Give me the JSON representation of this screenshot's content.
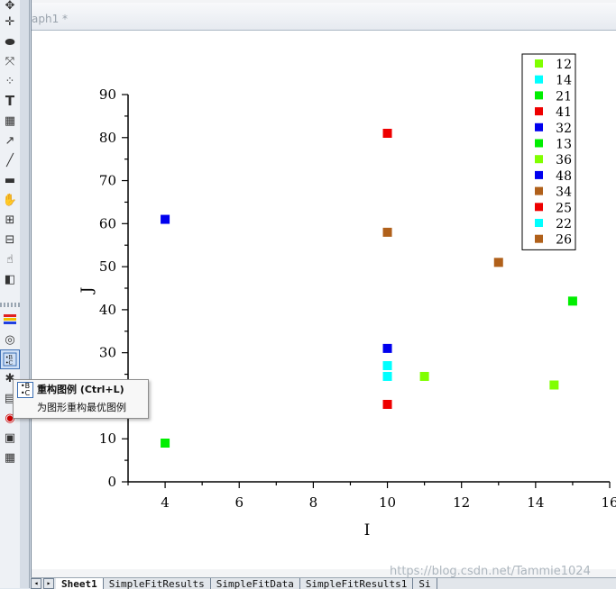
{
  "window": {
    "title": "aph1 *"
  },
  "chart_data": {
    "type": "scatter",
    "title": "",
    "xlabel": "I",
    "ylabel": "J",
    "xlim": [
      3,
      16
    ],
    "ylim": [
      0,
      90
    ],
    "xticks": [
      4,
      6,
      8,
      10,
      12,
      14,
      16
    ],
    "yticks": [
      0,
      10,
      20,
      30,
      40,
      50,
      60,
      70,
      80,
      90
    ],
    "legend_position": "top-right",
    "series": [
      {
        "name": "12",
        "color": "#80ff00",
        "points": [
          [
            14.5,
            22.5
          ]
        ]
      },
      {
        "name": "14",
        "color": "#00ffff",
        "points": [
          [
            10,
            24.5
          ]
        ]
      },
      {
        "name": "21",
        "color": "#00ee00",
        "points": [
          [
            4,
            9
          ]
        ]
      },
      {
        "name": "41",
        "color": "#ee0000",
        "points": [
          [
            10,
            81
          ]
        ]
      },
      {
        "name": "32",
        "color": "#0000ee",
        "points": [
          [
            10,
            31
          ]
        ]
      },
      {
        "name": "13",
        "color": "#00ee00",
        "points": [
          [
            15,
            42
          ]
        ]
      },
      {
        "name": "36",
        "color": "#80ff00",
        "points": [
          [
            11,
            24.5
          ]
        ]
      },
      {
        "name": "48",
        "color": "#0000ee",
        "points": [
          [
            4,
            61
          ]
        ]
      },
      {
        "name": "34",
        "color": "#b0601a",
        "points": [
          [
            10,
            58
          ]
        ]
      },
      {
        "name": "25",
        "color": "#ee0000",
        "points": [
          [
            10,
            18
          ]
        ]
      },
      {
        "name": "22",
        "color": "#00ffff",
        "points": [
          [
            10,
            27
          ]
        ]
      },
      {
        "name": "26",
        "color": "#b0601a",
        "points": [
          [
            13,
            51
          ]
        ]
      }
    ]
  },
  "tooltip": {
    "title": "重构图例 (Ctrl+L)",
    "description": "为图形重构最优图例"
  },
  "toolbar": {
    "tools": [
      "pointer-icon",
      "data-reader-icon",
      "screen-reader-icon",
      "data-selector-icon",
      "draw-data-icon",
      "text-icon",
      "add-table-icon",
      "arrow-icon",
      "line-icon",
      "rectangle-icon",
      "pan-icon",
      "zoom-in-icon",
      "scale-icon",
      "rotate-icon",
      "3d-icon",
      "color-scale-icon",
      "circle-icon",
      "reconstruct-legend-icon",
      "star-icon",
      "layer-icon",
      "mask-icon",
      "folder-icon",
      "table-icon"
    ]
  },
  "sheet_tabs": [
    "Sheet1",
    "SimpleFitResults",
    "SimpleFitData",
    "SimpleFitResults1",
    "Si"
  ],
  "watermark": "https://blog.csdn.net/Tammie1024"
}
